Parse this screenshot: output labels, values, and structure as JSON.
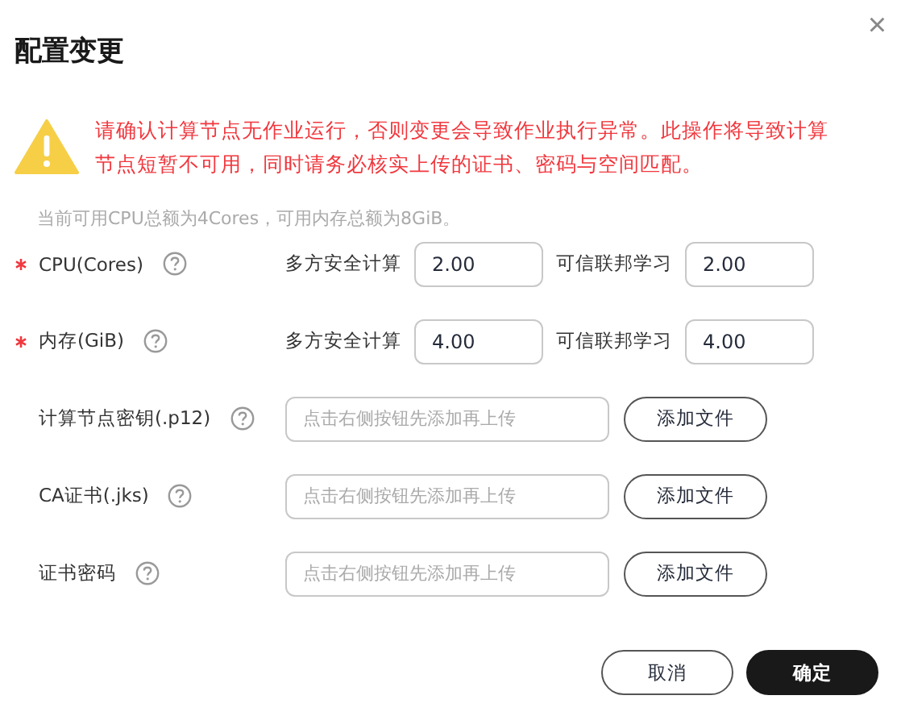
{
  "dialog": {
    "title": "配置变更",
    "close": "×"
  },
  "warning": "请确认计算节点无作业运行，否则变更会导致作业执行异常。此操作将导致计算节点短暂不可用，同时请务必核实上传的证书、密码与空间匹配。",
  "quota_note": "当前可用CPU总额为4Cores，可用内存总额为8GiB。",
  "resource_rows": [
    {
      "label": "CPU(Cores)",
      "required": true,
      "fields": [
        {
          "label": "多方安全计算",
          "value": "2.00"
        },
        {
          "label": "可信联邦学习",
          "value": "2.00"
        }
      ]
    },
    {
      "label": "内存(GiB)",
      "required": true,
      "fields": [
        {
          "label": "多方安全计算",
          "value": "4.00"
        },
        {
          "label": "可信联邦学习",
          "value": "4.00"
        }
      ]
    }
  ],
  "file_rows": [
    {
      "label": "计算节点密钥(.p12)",
      "placeholder": "点击右侧按钮先添加再上传",
      "button": "添加文件"
    },
    {
      "label": "CA证书(.jks)",
      "placeholder": "点击右侧按钮先添加再上传",
      "button": "添加文件"
    },
    {
      "label": "证书密码",
      "placeholder": "点击右侧按钮先添加再上传",
      "button": "添加文件"
    }
  ],
  "buttons": [
    {
      "label": "取消",
      "kind": "secondary"
    },
    {
      "label": "确定",
      "kind": "primary"
    }
  ]
}
